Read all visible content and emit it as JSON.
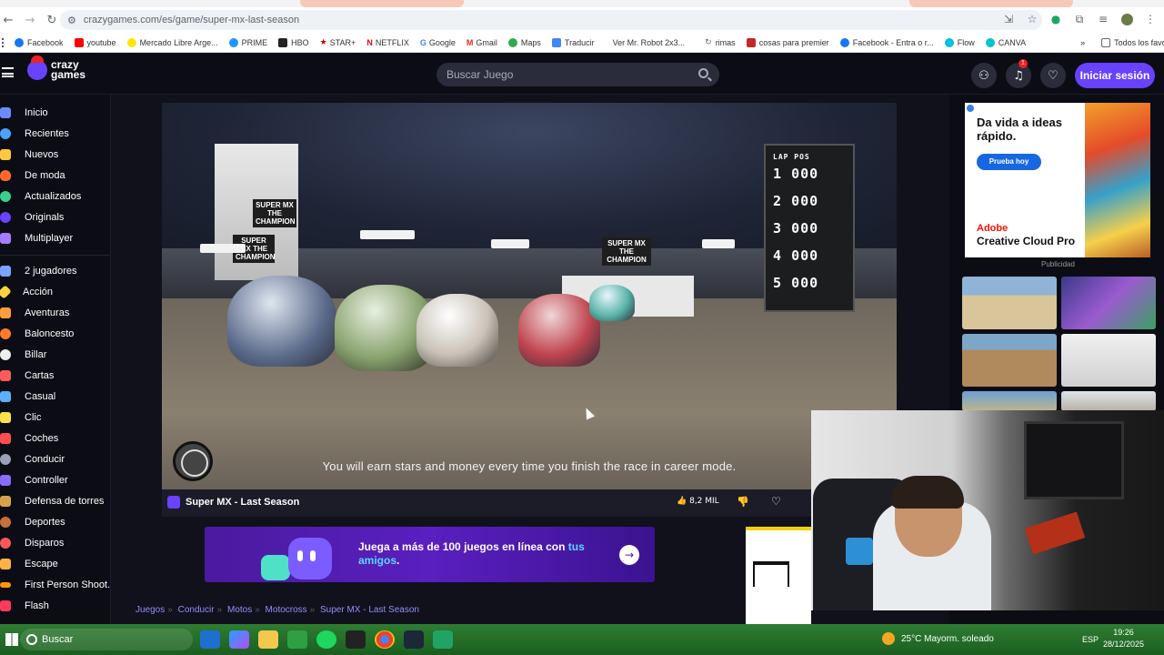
{
  "browser": {
    "url": "crazygames.com/es/game/super-mx-last-season",
    "bookmarks": [
      "Facebook",
      "youtube",
      "Mercado Libre Arge...",
      "PRIME",
      "HBO",
      "STAR+",
      "NETFLIX",
      "Google",
      "Gmail",
      "Maps",
      "Traducir",
      "Ver Mr. Robot 2x3...",
      "rimas",
      "cosas para premier",
      "Facebook - Entra o r...",
      "Flow",
      "CANVA"
    ],
    "bookmarks_more": "»",
    "all_favorites": "Todos los favoritos"
  },
  "header": {
    "logo_line1": "crazy",
    "logo_line2": "games",
    "search_placeholder": "Buscar Juego",
    "notification_count": "1",
    "signin": "Iniciar sesión"
  },
  "sidebar": {
    "main": [
      "Inicio",
      "Recientes",
      "Nuevos",
      "De moda",
      "Actualizados",
      "Originals",
      "Multiplayer"
    ],
    "categories": [
      "2 jugadores",
      "Acción",
      "Aventuras",
      "Baloncesto",
      "Billar",
      "Cartas",
      "Casual",
      "Clic",
      "Coches",
      "Conducir",
      "Controller",
      "Defensa de torres",
      "Deportes",
      "Disparos",
      "Escape",
      "First Person Shoot...",
      "Flash"
    ]
  },
  "game": {
    "subtitle": "You will earn stars and money every time you finish the race in career mode.",
    "scoreboard": [
      {
        "pos": "1",
        "val": "000"
      },
      {
        "pos": "2",
        "val": "000"
      },
      {
        "pos": "3",
        "val": "000"
      },
      {
        "pos": "4",
        "val": "000"
      },
      {
        "pos": "5",
        "val": "000"
      }
    ],
    "score_header": "LAP POS",
    "banner_text": "SUPER MX THE CHAMPION",
    "title": "Super MX - Last Season",
    "likes": "8,2 MIL"
  },
  "promo": {
    "text_pre": "Juega a más de 100 juegos en línea con ",
    "text_highlight": "tus",
    "text_line2_hl": "amigos",
    "text_end": "."
  },
  "breadcrumb": [
    "Juegos",
    "Conducir",
    "Motos",
    "Motocross",
    "Super MX - Last Season"
  ],
  "ad": {
    "headline": "Da vida a ideas rápido.",
    "cta": "Prueba hoy",
    "brand1": "Adobe",
    "brand2": "Creative Cloud Pro",
    "label": "Publicidad"
  },
  "taskbar": {
    "search": "Buscar",
    "weather": "25°C  Mayorm. soleado",
    "lang": "ESP",
    "time": "19:26",
    "date": "28/12/2025"
  },
  "colors": {
    "accent": "#6842ff",
    "bg": "#0c0d14",
    "taskbar": "#2e7d32"
  }
}
